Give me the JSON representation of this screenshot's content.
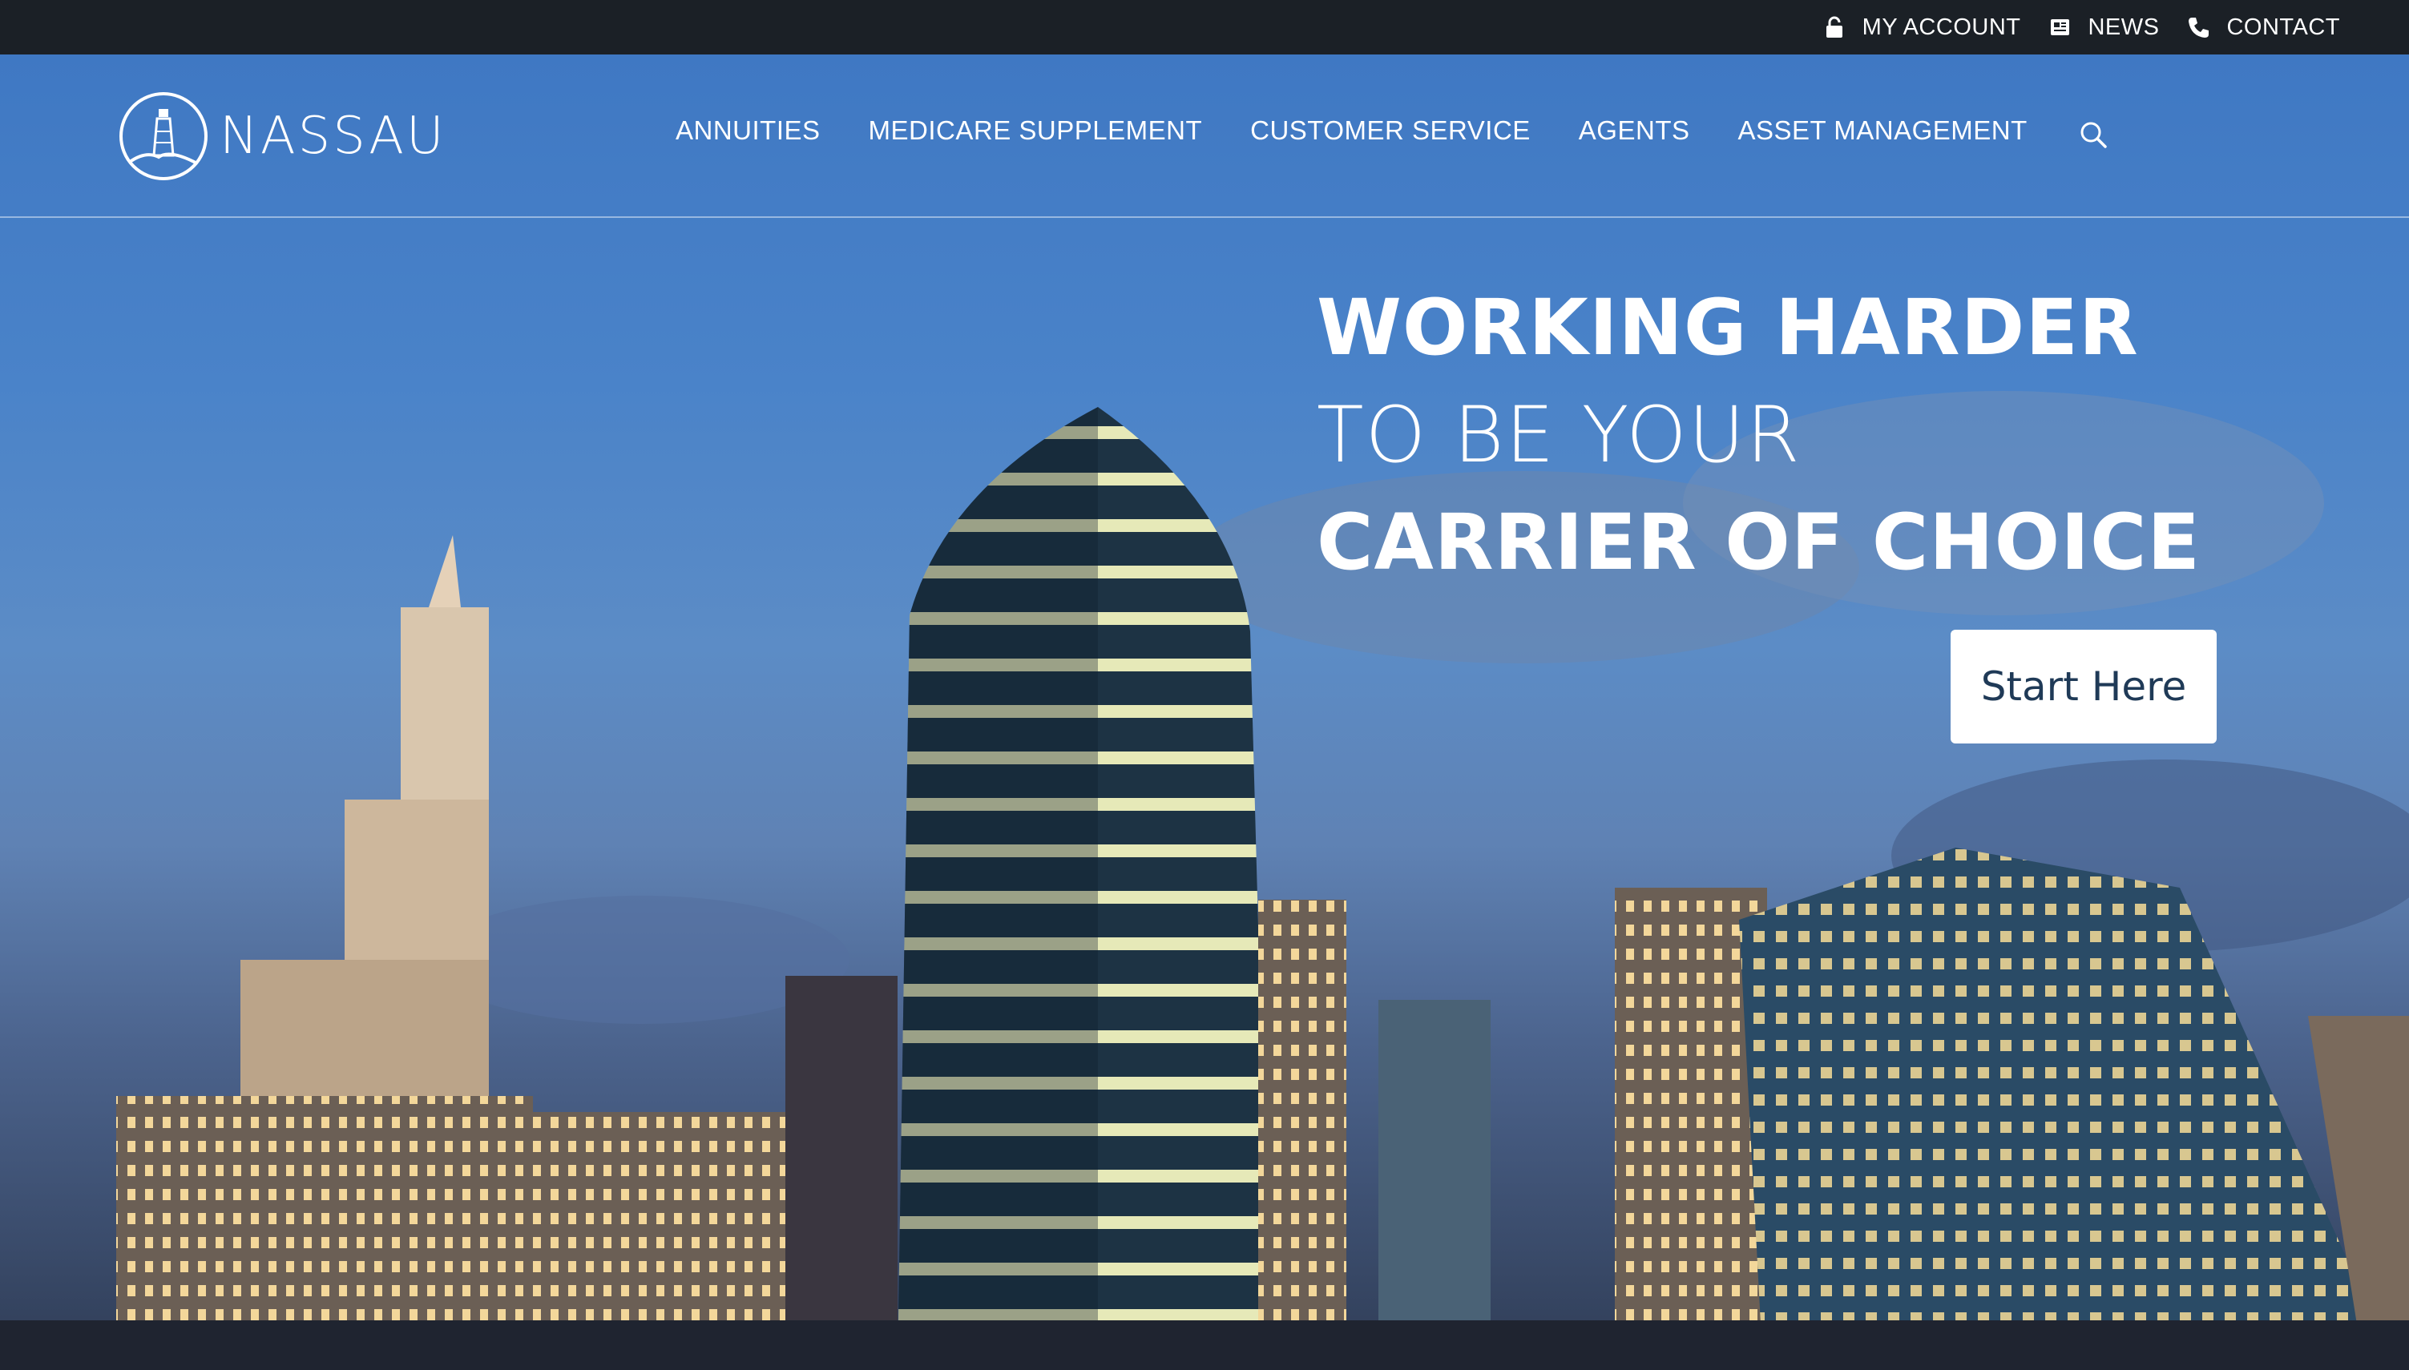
{
  "utility_nav": {
    "my_account": "MY ACCOUNT",
    "news": "NEWS",
    "contact": "CONTACT"
  },
  "header": {
    "logo_text": "NASSAU",
    "nav": [
      "ANNUITIES",
      "MEDICARE SUPPLEMENT",
      "CUSTOMER SERVICE",
      "AGENTS",
      "ASSET MANAGEMENT"
    ],
    "search_icon": "search-icon"
  },
  "hero": {
    "line1": "WORKING HARDER",
    "line2": "TO BE YOUR",
    "line3": "CARRIER OF CHOICE",
    "cta_label": "Start Here"
  },
  "colors": {
    "topbar": "#1b2026",
    "sky": "#4a83c9",
    "cta_text": "#1f3a57",
    "white": "#ffffff"
  }
}
